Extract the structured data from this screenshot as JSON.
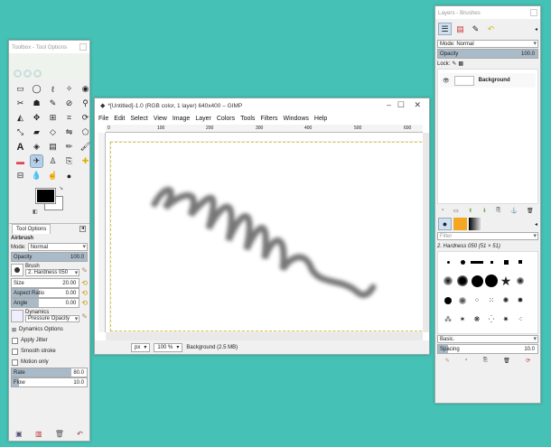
{
  "toolbox": {
    "title": "Toolbox - Tool Options",
    "tab_label": "Tool Options",
    "tool_name": "Airbrush",
    "mode_label": "Mode:",
    "mode_value": "Normal",
    "opacity_label": "Opacity",
    "opacity_value": "100.0",
    "brush_label": "Brush",
    "brush_value": "2. Hardness 050",
    "size_label": "Size",
    "size_value": "20.00",
    "aspect_label": "Aspect Ratio",
    "aspect_value": "0.00",
    "angle_label": "Angle",
    "angle_value": "0.00",
    "dynamics_label": "Dynamics",
    "dynamics_value": "Pressure Opacity",
    "dynamics_options": "Dynamics Options",
    "apply_jitter": "Apply Jitter",
    "smooth_stroke": "Smooth stroke",
    "motion_only": "Motion only",
    "rate_label": "Rate",
    "rate_value": "80.0",
    "flow_label": "Flow",
    "flow_value": "10.0"
  },
  "gimp": {
    "title": "*[Untitled]-1.0 (RGB color, 1 layer) 640x400 – GIMP",
    "menu": [
      "File",
      "Edit",
      "Select",
      "View",
      "Image",
      "Layer",
      "Colors",
      "Tools",
      "Filters",
      "Windows",
      "Help"
    ],
    "ruler_ticks": [
      "0",
      "100",
      "200",
      "300",
      "400",
      "500",
      "600"
    ],
    "unit": "px",
    "zoom": "100 %",
    "status": "Background (2.5 MB)"
  },
  "layers": {
    "title": "Layers - Brushes",
    "mode_label": "Mode: Normal",
    "opacity_label": "Opacity",
    "opacity_value": "100.0",
    "lock_label": "Lock:",
    "layer_name": "Background",
    "filter_placeholder": "Filter",
    "brush_name": "2. Hardness 050 (51 × 51)",
    "preset": "Basic.",
    "spacing_label": "Spacing",
    "spacing_value": "10.0"
  }
}
